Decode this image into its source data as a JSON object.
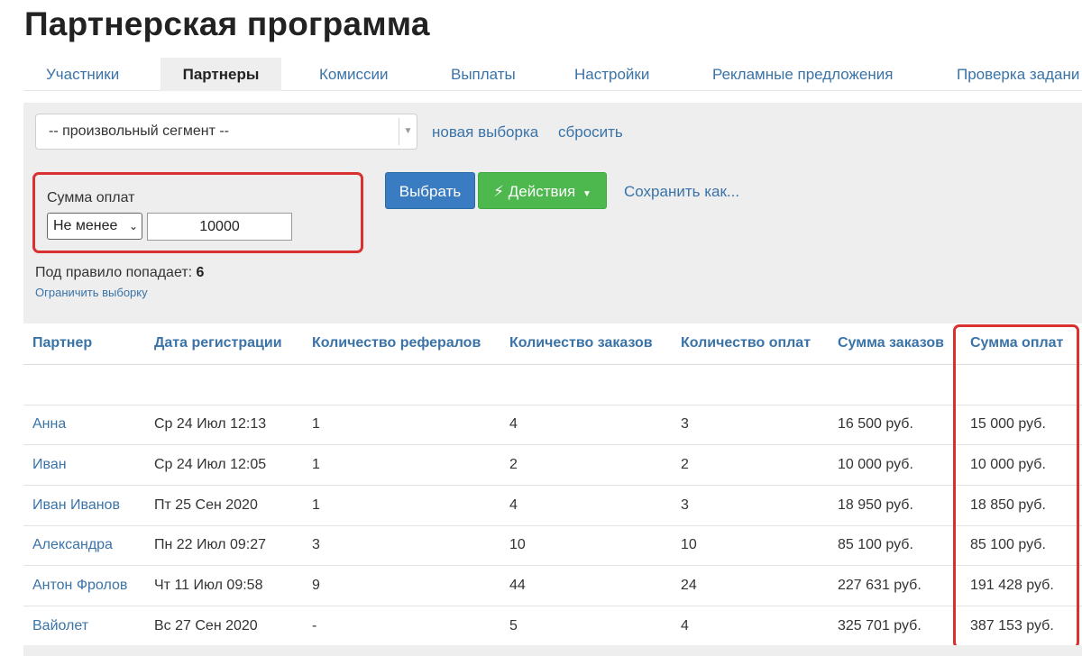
{
  "page": {
    "title": "Партнерская программа"
  },
  "tabs": [
    {
      "label": "Участники",
      "active": false
    },
    {
      "label": "Партнеры",
      "active": true
    },
    {
      "label": "Комиссии",
      "active": false
    },
    {
      "label": "Выплаты",
      "active": false
    },
    {
      "label": "Настройки",
      "active": false
    },
    {
      "label": "Рекламные предложения",
      "active": false
    },
    {
      "label": "Проверка задани",
      "active": false
    }
  ],
  "filter": {
    "segment_value": "-- произвольный сегмент --",
    "new_selection": "новая выборка",
    "reset": "сбросить",
    "rule": {
      "label": "Сумма оплат",
      "operator": "Не менее",
      "value": "10000"
    },
    "select_button": "Выбрать",
    "actions_button": "Действия",
    "save_as": "Сохранить как...",
    "match_prefix": "Под правило попадает:",
    "match_count": "6",
    "limit_link": "Ограничить выборку"
  },
  "table": {
    "headers": [
      "Партнер",
      "Дата регистрации",
      "Количество рефералов",
      "Количество заказов",
      "Количество оплат",
      "Сумма заказов",
      "Сумма оплат"
    ],
    "rows": [
      [
        "Анна",
        "Ср 24 Июл 12:13",
        "1",
        "4",
        "3",
        "16 500 руб.",
        "15 000 руб."
      ],
      [
        "Иван",
        "Ср 24 Июл 12:05",
        "1",
        "2",
        "2",
        "10 000 руб.",
        "10 000 руб."
      ],
      [
        "Иван Иванов",
        "Пт 25 Сен 2020",
        "1",
        "4",
        "3",
        "18 950 руб.",
        "18 850 руб."
      ],
      [
        "Александра",
        "Пн 22 Июл 09:27",
        "3",
        "10",
        "10",
        "85 100 руб.",
        "85 100 руб."
      ],
      [
        "Антон Фролов",
        "Чт 11 Июл 09:58",
        "9",
        "44",
        "24",
        "227 631 руб.",
        "191 428 руб."
      ],
      [
        "Вайолет",
        "Вс 27 Сен 2020",
        "-",
        "5",
        "4",
        "325 701 руб.",
        "387 153 руб."
      ]
    ]
  },
  "colors": {
    "link": "#3a73a8",
    "primary_button": "#3a7cc2",
    "success_button": "#4cb84e",
    "highlight": "#d93030"
  },
  "icons": {
    "actions": "lightning-icon",
    "segment_dropdown": "chevron-down-icon"
  }
}
